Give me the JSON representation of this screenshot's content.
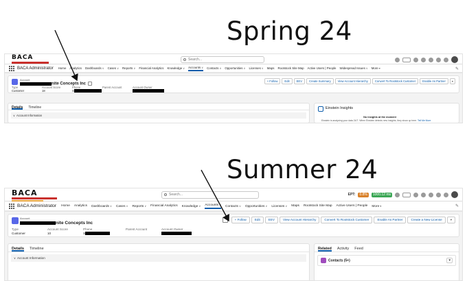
{
  "headings": {
    "top": "Spring 24",
    "bottom": "Summer 24"
  },
  "spring": {
    "logo": "BACA",
    "search_placeholder": "Search...",
    "app_name": "BACA Administrator",
    "nav": [
      "Home",
      "Analytics",
      "Dashboards",
      "Cases",
      "Reports",
      "Financial Analytics",
      "Knowledge",
      "Accounts",
      "Contacts",
      "Opportunities",
      "Licenses",
      "Maps",
      "Rootstock Site Map",
      "Active Users | People",
      "Widespread Issues",
      "More"
    ],
    "nav_active": "Accounts",
    "record_label": "Account",
    "record_name_suffix": "nite Concepts Inc",
    "fields": [
      {
        "label": "Type",
        "value": "Customer"
      },
      {
        "label": "Account Score",
        "value": "18"
      },
      {
        "label": "Phone",
        "value": "S"
      },
      {
        "label": "Parent Account",
        "value": ""
      },
      {
        "label": "Account Owner",
        "value": ""
      }
    ],
    "buttons": [
      "+ Follow",
      "Edit",
      "EEV",
      "Create Summary",
      "View Account Hierarchy",
      "Convert To Rootstock Customer",
      "Enable As Partner"
    ],
    "tabs": [
      "Details",
      "Timeline"
    ],
    "section": "Account Information",
    "einstein": {
      "title": "Einstein Insights",
      "message": "No insights at the moment",
      "sub": "Einstein is analyzing your data 24/7. When Einstein detects new insights, they show up here.",
      "link": "Tell Me More"
    }
  },
  "summer": {
    "logo": "BACA",
    "search_placeholder": "Search...",
    "ept_label": "EPT:",
    "badge1": "0.8%",
    "badge2": "1000.12 ms",
    "app_name": "BACA Administrator",
    "nav": [
      "Home",
      "Analytics",
      "Dashboards",
      "Cases",
      "Reports",
      "Financial Analytics",
      "Knowledge",
      "Accounts",
      "Contacts",
      "Opportunities",
      "Licenses",
      "Maps",
      "Rootstock Site Map",
      "Active Users | People",
      "More"
    ],
    "nav_active": "Accounts",
    "record_label": "Account",
    "record_name_suffix": "nite Concepts Inc",
    "fields": [
      {
        "label": "Type",
        "value": "Customer"
      },
      {
        "label": "Account Score",
        "value": "10"
      },
      {
        "label": "Phone",
        "value": "S"
      },
      {
        "label": "Parent Account",
        "value": ""
      },
      {
        "label": "Account Owner",
        "value": ""
      }
    ],
    "buttons": [
      "+ Follow",
      "Edit",
      "EEV",
      "View Account Hierarchy",
      "Convert To Rootstock Customer",
      "Enable As Partner",
      "Create a New License"
    ],
    "tabs": [
      "Details",
      "Timeline"
    ],
    "right_tabs": [
      "Related",
      "Activity",
      "Feed"
    ],
    "section": "Account Information",
    "contacts": "Contacts (5+)"
  }
}
